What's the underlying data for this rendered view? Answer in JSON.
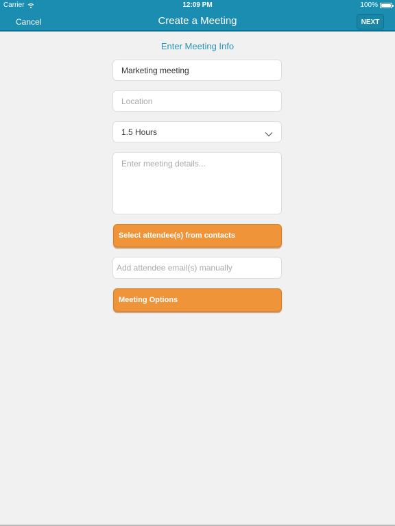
{
  "status_bar": {
    "carrier": "Carrier",
    "time": "12:09 PM",
    "battery": "100%"
  },
  "nav": {
    "cancel": "Cancel",
    "title": "Create a Meeting",
    "next": "NEXT"
  },
  "form": {
    "section_title": "Enter Meeting Info",
    "title_value": "Marketing meeting",
    "location_placeholder": "Location",
    "duration_value": "1.5 Hours",
    "details_placeholder": "Enter meeting details...",
    "select_attendees_button": "Select attendee(s) from contacts",
    "attendee_email_placeholder": "Add attendee email(s) manually",
    "meeting_options_button": "Meeting Options"
  },
  "colors": {
    "header": "#1a8db0",
    "accent_text": "#2a94b5",
    "orange": "#f0943a",
    "background": "#f1f1f1"
  },
  "icons": {
    "wifi": "wifi-icon",
    "battery": "battery-icon",
    "dropdown": "chevron-down-icon"
  }
}
